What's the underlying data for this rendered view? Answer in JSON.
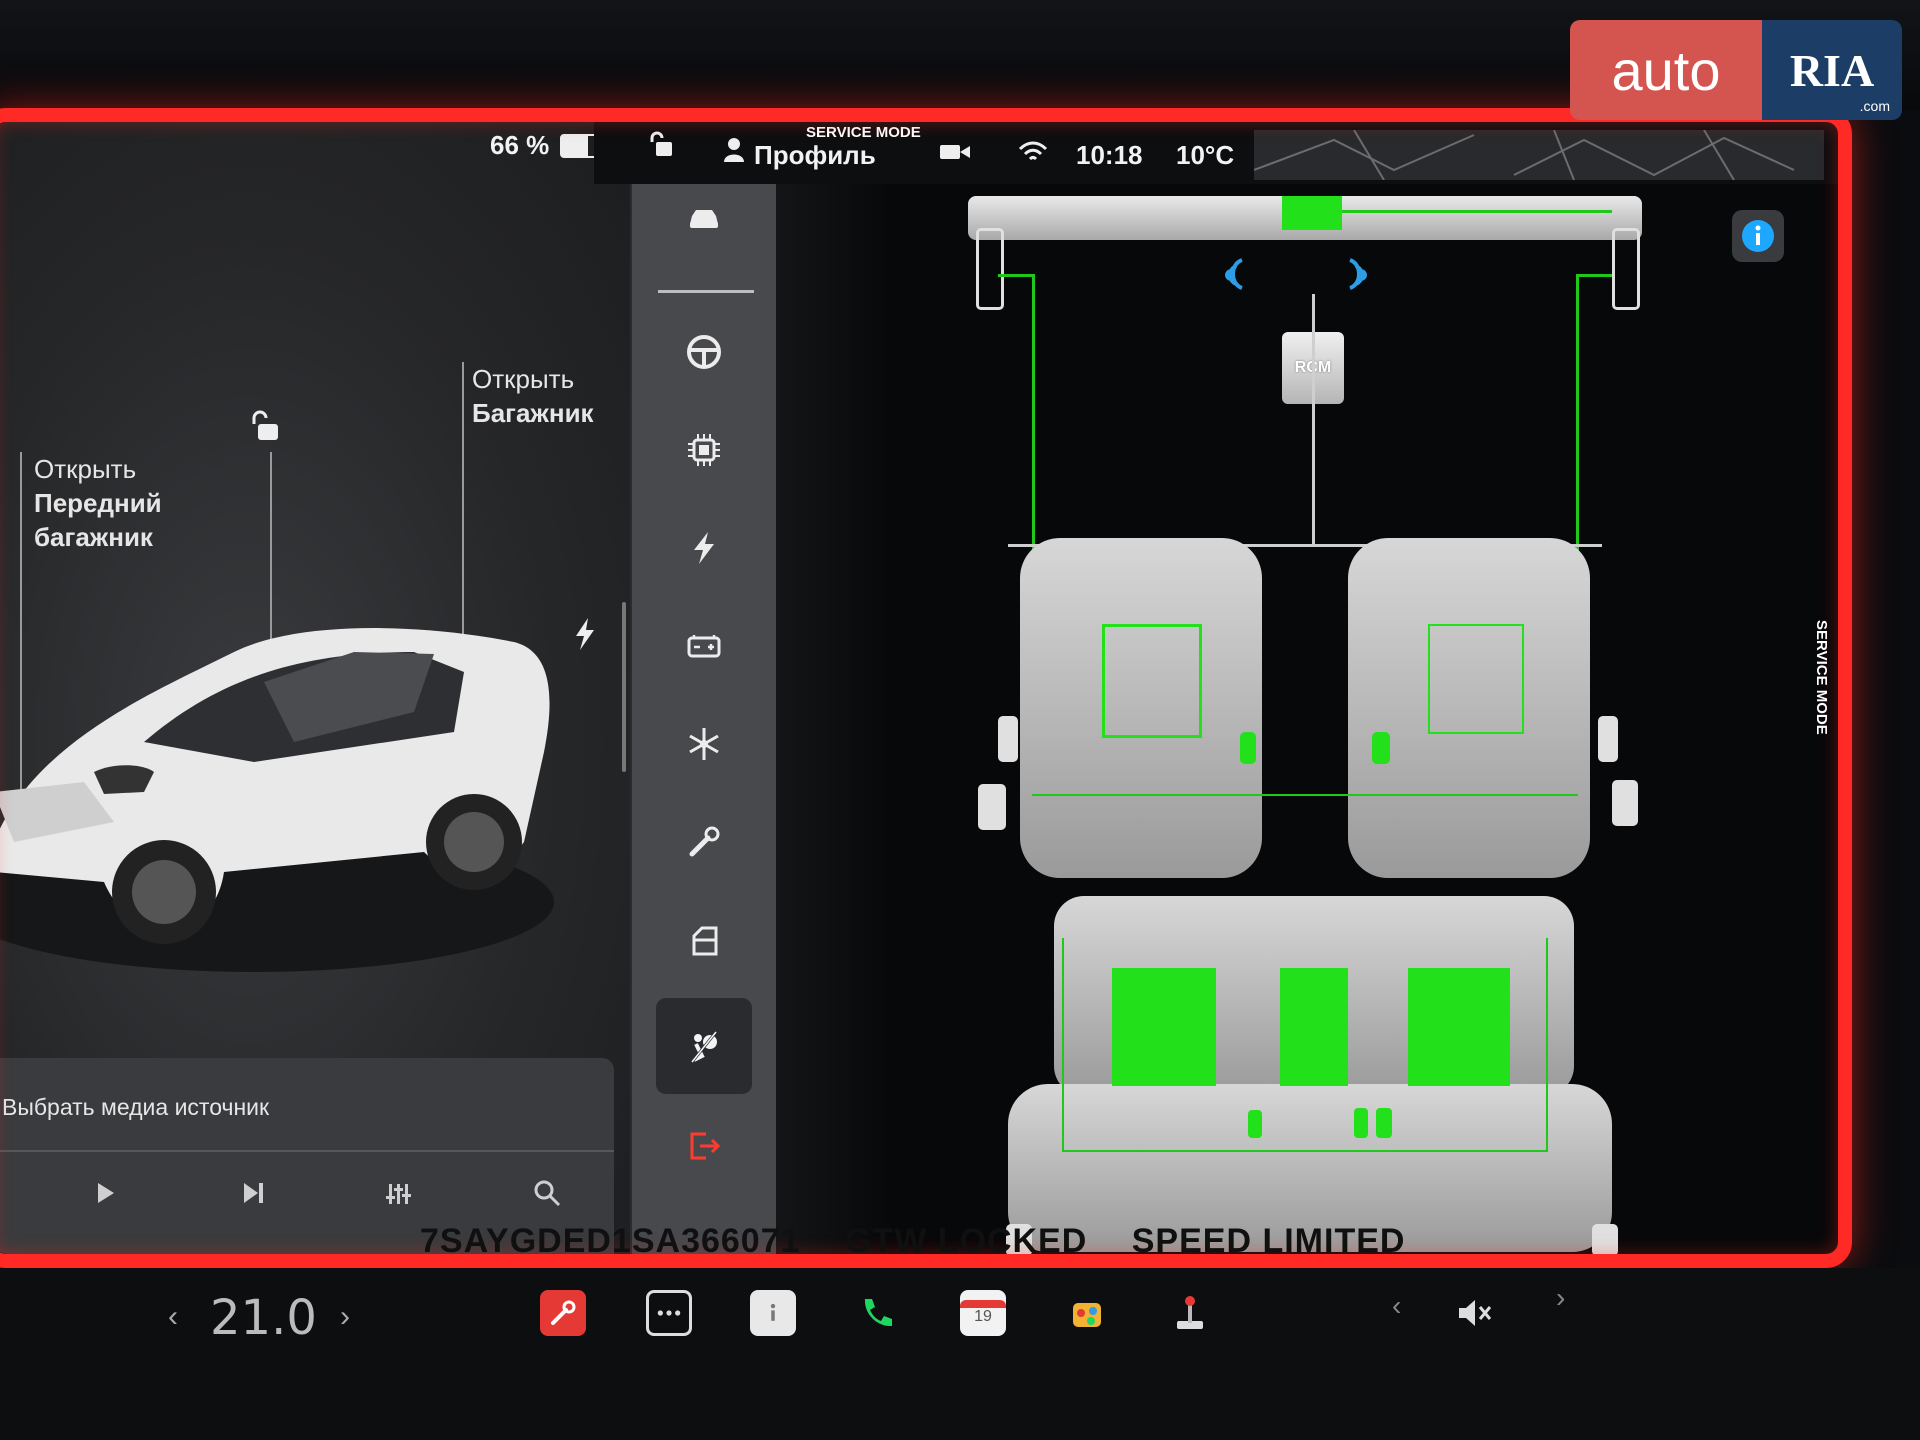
{
  "status_bar": {
    "battery_percent_label": "66 %",
    "battery_level": 0.66,
    "service_mode_label": "SERVICE MODE",
    "profile_label": "Профиль",
    "time": "10:18",
    "temperature": "10°C"
  },
  "car_panel": {
    "frunk_label_line1": "Открыть",
    "frunk_label_line2": "Передний",
    "frunk_label_line3": "багажник",
    "trunk_label_line1": "Открыть",
    "trunk_label_line2": "Багажник"
  },
  "media": {
    "source_label": "Выбрать медиа источник",
    "icons": [
      "play-icon",
      "next-track-icon",
      "equalizer-icon",
      "search-icon"
    ]
  },
  "sidebar": {
    "items": [
      "car-icon",
      "steering-wheel-icon",
      "chip-icon",
      "lightning-icon",
      "battery-icon",
      "snowflake-icon",
      "wrench-icon",
      "door-icon",
      "airbag-icon",
      "exit-icon"
    ],
    "active": "airbag-icon"
  },
  "diagram": {
    "module_label": "RCM",
    "active_color": "#22e01a",
    "info_icon": "info-icon"
  },
  "footer_codes": {
    "vin": "7SAYGDED1SA366071",
    "gtw": "GTW LOCKED",
    "speed": "SPEED LIMITED",
    "side_service": "SERVICE MODE"
  },
  "taskbar": {
    "temperature_setpoint": "21.0",
    "calendar_day": "19",
    "icons": [
      "service-wrench-icon",
      "more-apps-icon",
      "manual-icon",
      "phone-icon",
      "calendar-icon",
      "games-icon",
      "joystick-icon",
      "volume-mute-icon"
    ]
  },
  "watermark": {
    "brand_left": "auto",
    "brand_right": "RIA",
    "brand_suffix": ".com"
  }
}
